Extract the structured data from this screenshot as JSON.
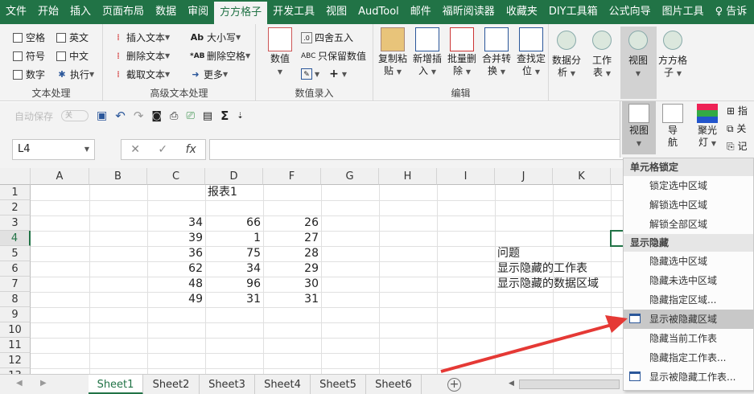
{
  "tabs": [
    "文件",
    "开始",
    "插入",
    "页面布局",
    "数据",
    "审阅",
    "方方格子",
    "开发工具",
    "视图",
    "AudTool",
    "邮件",
    "福昕阅读器",
    "收藏夹",
    "DIY工具箱",
    "公式向导",
    "图片工具",
    "♀ 告诉"
  ],
  "active_tab": "方方格子",
  "text_group": {
    "label": "文本处理",
    "items": [
      "空格",
      "英文",
      "符号",
      "中文",
      "数字",
      "执行"
    ]
  },
  "adv_text_group": {
    "label": "高级文本处理",
    "items": [
      "插入文本",
      "删除文本",
      "截取文本",
      "大小写",
      "删除空格",
      "更多"
    ]
  },
  "numeric_group": {
    "label": "数值录入",
    "numeric_label": "数值",
    "round_label": "四舍五入",
    "keep_label": "只保留数值"
  },
  "edit_group": {
    "label": "编辑",
    "buttons": [
      {
        "line1": "复制粘",
        "line2": "贴"
      },
      {
        "line1": "新增插",
        "line2": "入"
      },
      {
        "line1": "批量删",
        "line2": "除"
      },
      {
        "line1": "合并转",
        "line2": "换"
      },
      {
        "line1": "查找定",
        "line2": "位"
      }
    ]
  },
  "right_ribbon": {
    "analyze": {
      "line1": "数据分",
      "line2": "析"
    },
    "sheet": {
      "line1": "工作",
      "line2": "表"
    },
    "view": "视图",
    "ffgz": {
      "line1": "方方格",
      "line2": "子"
    }
  },
  "qat": {
    "autosave": "自动保存",
    "toggle": "关"
  },
  "formula_bar": {
    "name_box": "L4",
    "fx": "fx"
  },
  "columns": [
    "A",
    "B",
    "C",
    "D",
    "F",
    "G",
    "H",
    "I",
    "J",
    "K"
  ],
  "rows": [
    "1",
    "2",
    "3",
    "4",
    "5",
    "6",
    "7",
    "8",
    "9",
    "10",
    "11",
    "12",
    "13"
  ],
  "cells": {
    "title": "报表1",
    "colC": [
      "34",
      "39",
      "36",
      "62",
      "48",
      "49"
    ],
    "colD": [
      "66",
      "1",
      "75",
      "34",
      "96",
      "31"
    ],
    "colF": [
      "26",
      "27",
      "28",
      "29",
      "30",
      "31"
    ],
    "notes": [
      "问题",
      "显示隐藏的工作表",
      "显示隐藏的数据区域"
    ]
  },
  "sheets": [
    "Sheet1",
    "Sheet2",
    "Sheet3",
    "Sheet4",
    "Sheet5",
    "Sheet6"
  ],
  "active_sheet": "Sheet1",
  "popup_buttons": [
    {
      "line1": "视图",
      "line2": ""
    },
    {
      "line1": "导",
      "line2": "航"
    },
    {
      "line1": "聚光",
      "line2": "灯"
    }
  ],
  "popup_right": [
    "指",
    "关",
    "记"
  ],
  "menu": {
    "section1": "单元格锁定",
    "section1_items": [
      "锁定选中区域",
      "解锁选中区域",
      "解锁全部区域"
    ],
    "section2": "显示隐藏",
    "section2_items": [
      "隐藏选中区域",
      "隐藏未选中区域",
      "隐藏指定区域...",
      "显示被隐藏区域",
      "隐藏当前工作表",
      "隐藏指定工作表...",
      "显示被隐藏工作表..."
    ],
    "highlighted": "显示被隐藏区域"
  },
  "colors": {
    "accent": "#217346",
    "arrow": "#e53935"
  }
}
